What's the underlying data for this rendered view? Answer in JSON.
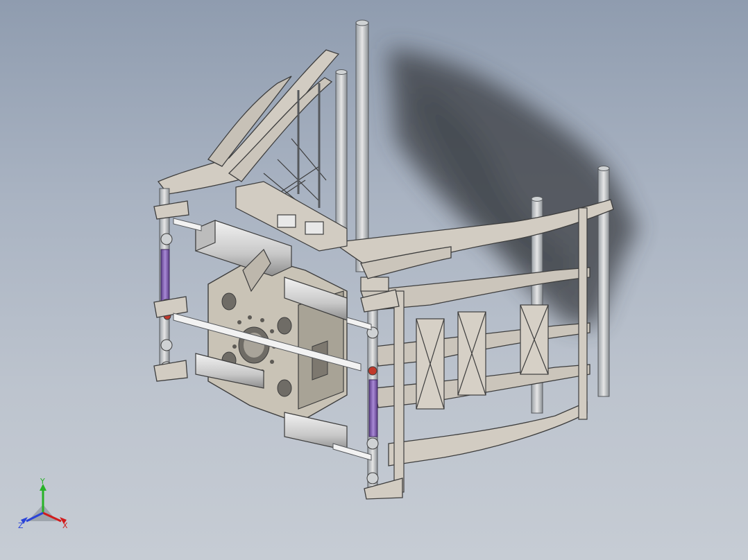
{
  "viewport": {
    "background_top": "#8f9caf",
    "background_bottom": "#c6ccd4"
  },
  "model": {
    "description_icon": "assembly-3d-frame",
    "part_color": "#d2ccc2",
    "shadow_color": "#3a3d42",
    "rod_color": "#8a6bb5",
    "cylinder_color": "#e6e6e6"
  },
  "triad": {
    "x_label": "X",
    "y_label": "Y",
    "z_label": "Z",
    "x_color": "#d11c1c",
    "y_color": "#27b227",
    "z_color": "#2a43d8"
  }
}
